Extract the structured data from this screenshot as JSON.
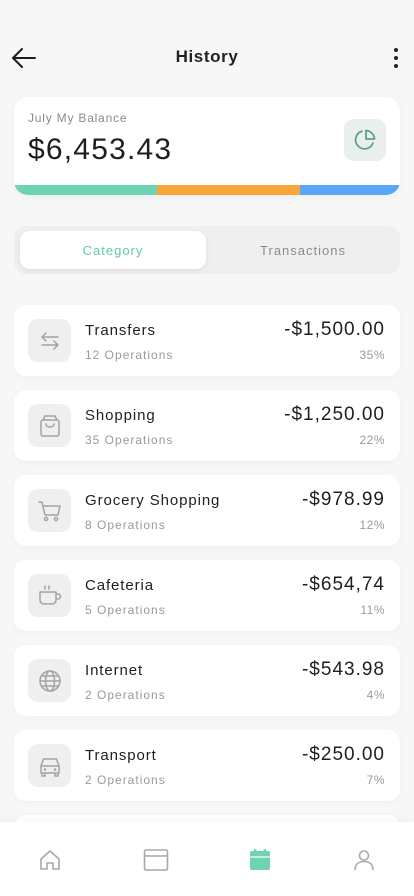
{
  "header": {
    "title": "History",
    "back_icon": "arrow-left-icon",
    "more_icon": "more-vertical-icon"
  },
  "balance": {
    "label": "July My Balance",
    "amount": "$6,453.43",
    "chart_icon": "pie-chart-icon",
    "segments": [
      {
        "color": "#6ed3b3",
        "share": 0.37
      },
      {
        "color": "#f7a738",
        "share": 0.37
      },
      {
        "color": "#58a6f5",
        "share": 0.26
      }
    ]
  },
  "tabs": [
    {
      "label": "Category",
      "active": true
    },
    {
      "label": "Transactions",
      "active": false
    }
  ],
  "categories": [
    {
      "name": "Transfers",
      "operations": "12 Operations",
      "amount": "-$1,500.00",
      "percent": "35%",
      "icon": "transfer-arrows-icon"
    },
    {
      "name": "Shopping",
      "operations": "35 Operations",
      "amount": "-$1,250.00",
      "percent": "22%",
      "icon": "shopping-bag-icon"
    },
    {
      "name": "Grocery Shopping",
      "operations": "8 Operations",
      "amount": "-$978.99",
      "percent": "12%",
      "icon": "shopping-cart-icon"
    },
    {
      "name": "Cafeteria",
      "operations": "5 Operations",
      "amount": "-$654,74",
      "percent": "11%",
      "icon": "coffee-cup-icon"
    },
    {
      "name": "Internet",
      "operations": "2 Operations",
      "amount": "-$543.98",
      "percent": "4%",
      "icon": "globe-icon"
    },
    {
      "name": "Transport",
      "operations": "2 Operations",
      "amount": "-$250.00",
      "percent": "7%",
      "icon": "car-icon"
    }
  ],
  "tabbar": [
    {
      "name": "home",
      "icon": "home-icon",
      "active": false
    },
    {
      "name": "cards",
      "icon": "card-icon",
      "active": false
    },
    {
      "name": "history",
      "icon": "calendar-icon",
      "active": true
    },
    {
      "name": "profile",
      "icon": "user-icon",
      "active": false
    }
  ],
  "colors": {
    "accent": "#5fc9a9",
    "icon_gray": "#a3a3a3"
  }
}
